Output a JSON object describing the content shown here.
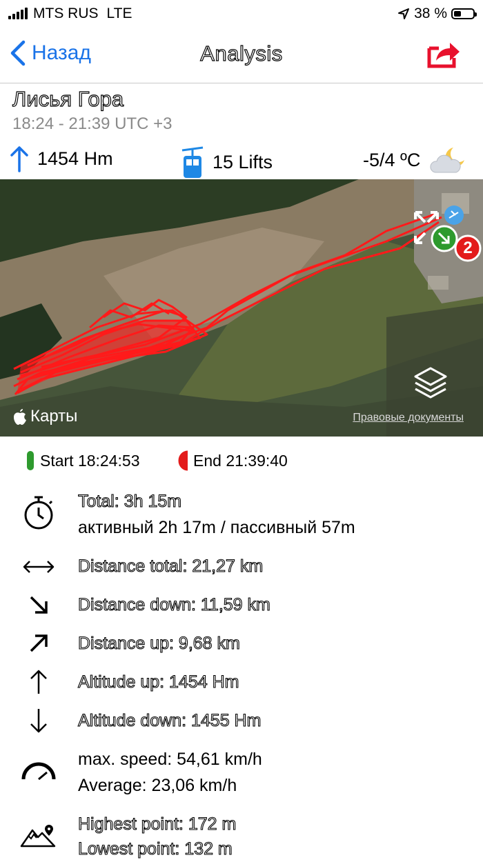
{
  "status": {
    "carrier": "MTS RUS",
    "network": "LTE",
    "battery": "38 %"
  },
  "nav": {
    "back_label": "Назад",
    "title": "Analysis"
  },
  "session": {
    "resort": "Лисья Гора",
    "time_range": "18:24 - 21:39 UTC +3"
  },
  "summary": {
    "altitude": "1454 Hm",
    "lifts": "15 Lifts",
    "temperature": "-5/4 ºC"
  },
  "map": {
    "label": "Карты",
    "legal": "Правовые документы",
    "marker_count": "2",
    "track_color": "#ff1a1a"
  },
  "start_end": {
    "start": "Start 18:24:53",
    "end": "End 21:39:40"
  },
  "details": {
    "total": "Total: 3h 15m",
    "active_passive": "активный 2h 17m / пассивный 57m",
    "distance_total": "Distance total: 21,27 km",
    "distance_down": "Distance down: 11,59 km",
    "distance_up": "Distance up: 9,68 km",
    "altitude_up": "Altitude up: 1454 Hm",
    "altitude_down": "Altitude down: 1455 Hm",
    "max_speed": "max. speed: 54,61 km/h",
    "average": "Average: 23,06 km/h",
    "highest": "Highest point: 172 m",
    "lowest": "Lowest point: 132 m"
  },
  "colors": {
    "accent": "#1a73e8",
    "share": "#e8112d",
    "lift": "#1e88e5",
    "start": "#2e9a2e",
    "end": "#e31b1b"
  }
}
